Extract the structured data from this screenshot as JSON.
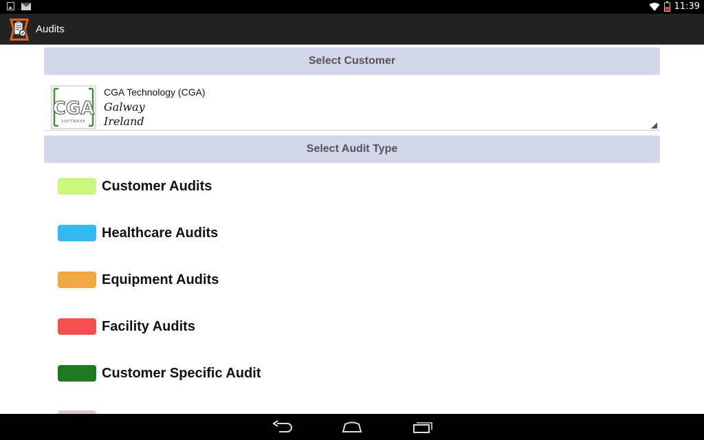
{
  "status_bar": {
    "time": "11:39",
    "left_icons": [
      "image-icon",
      "mail-icon"
    ],
    "right_icons": [
      "wifi-icon",
      "battery-icon"
    ]
  },
  "action_bar": {
    "title": "Audits",
    "logo_icon": "audit-clipboard-icon"
  },
  "customer_section": {
    "header": "Select Customer",
    "selected": {
      "name": "CGA Technology (CGA)",
      "city": "Galway",
      "country": "Ireland",
      "logo_text": "CGA",
      "logo_subtext": "SOFTWARE"
    }
  },
  "audit_section": {
    "header": "Select Audit Type",
    "items": [
      {
        "label": "Customer Audits",
        "color": "#c8f77a"
      },
      {
        "label": "Healthcare Audits",
        "color": "#33b8f0"
      },
      {
        "label": "Equipment Audits",
        "color": "#f0a843"
      },
      {
        "label": "Facility Audits",
        "color": "#f54f4f"
      },
      {
        "label": "Customer Specific Audit",
        "color": "#1f7a1f"
      }
    ],
    "partially_visible_color": "#e4c7c7"
  },
  "nav_bar": {
    "buttons": [
      "back-icon",
      "home-icon",
      "recents-icon"
    ]
  }
}
